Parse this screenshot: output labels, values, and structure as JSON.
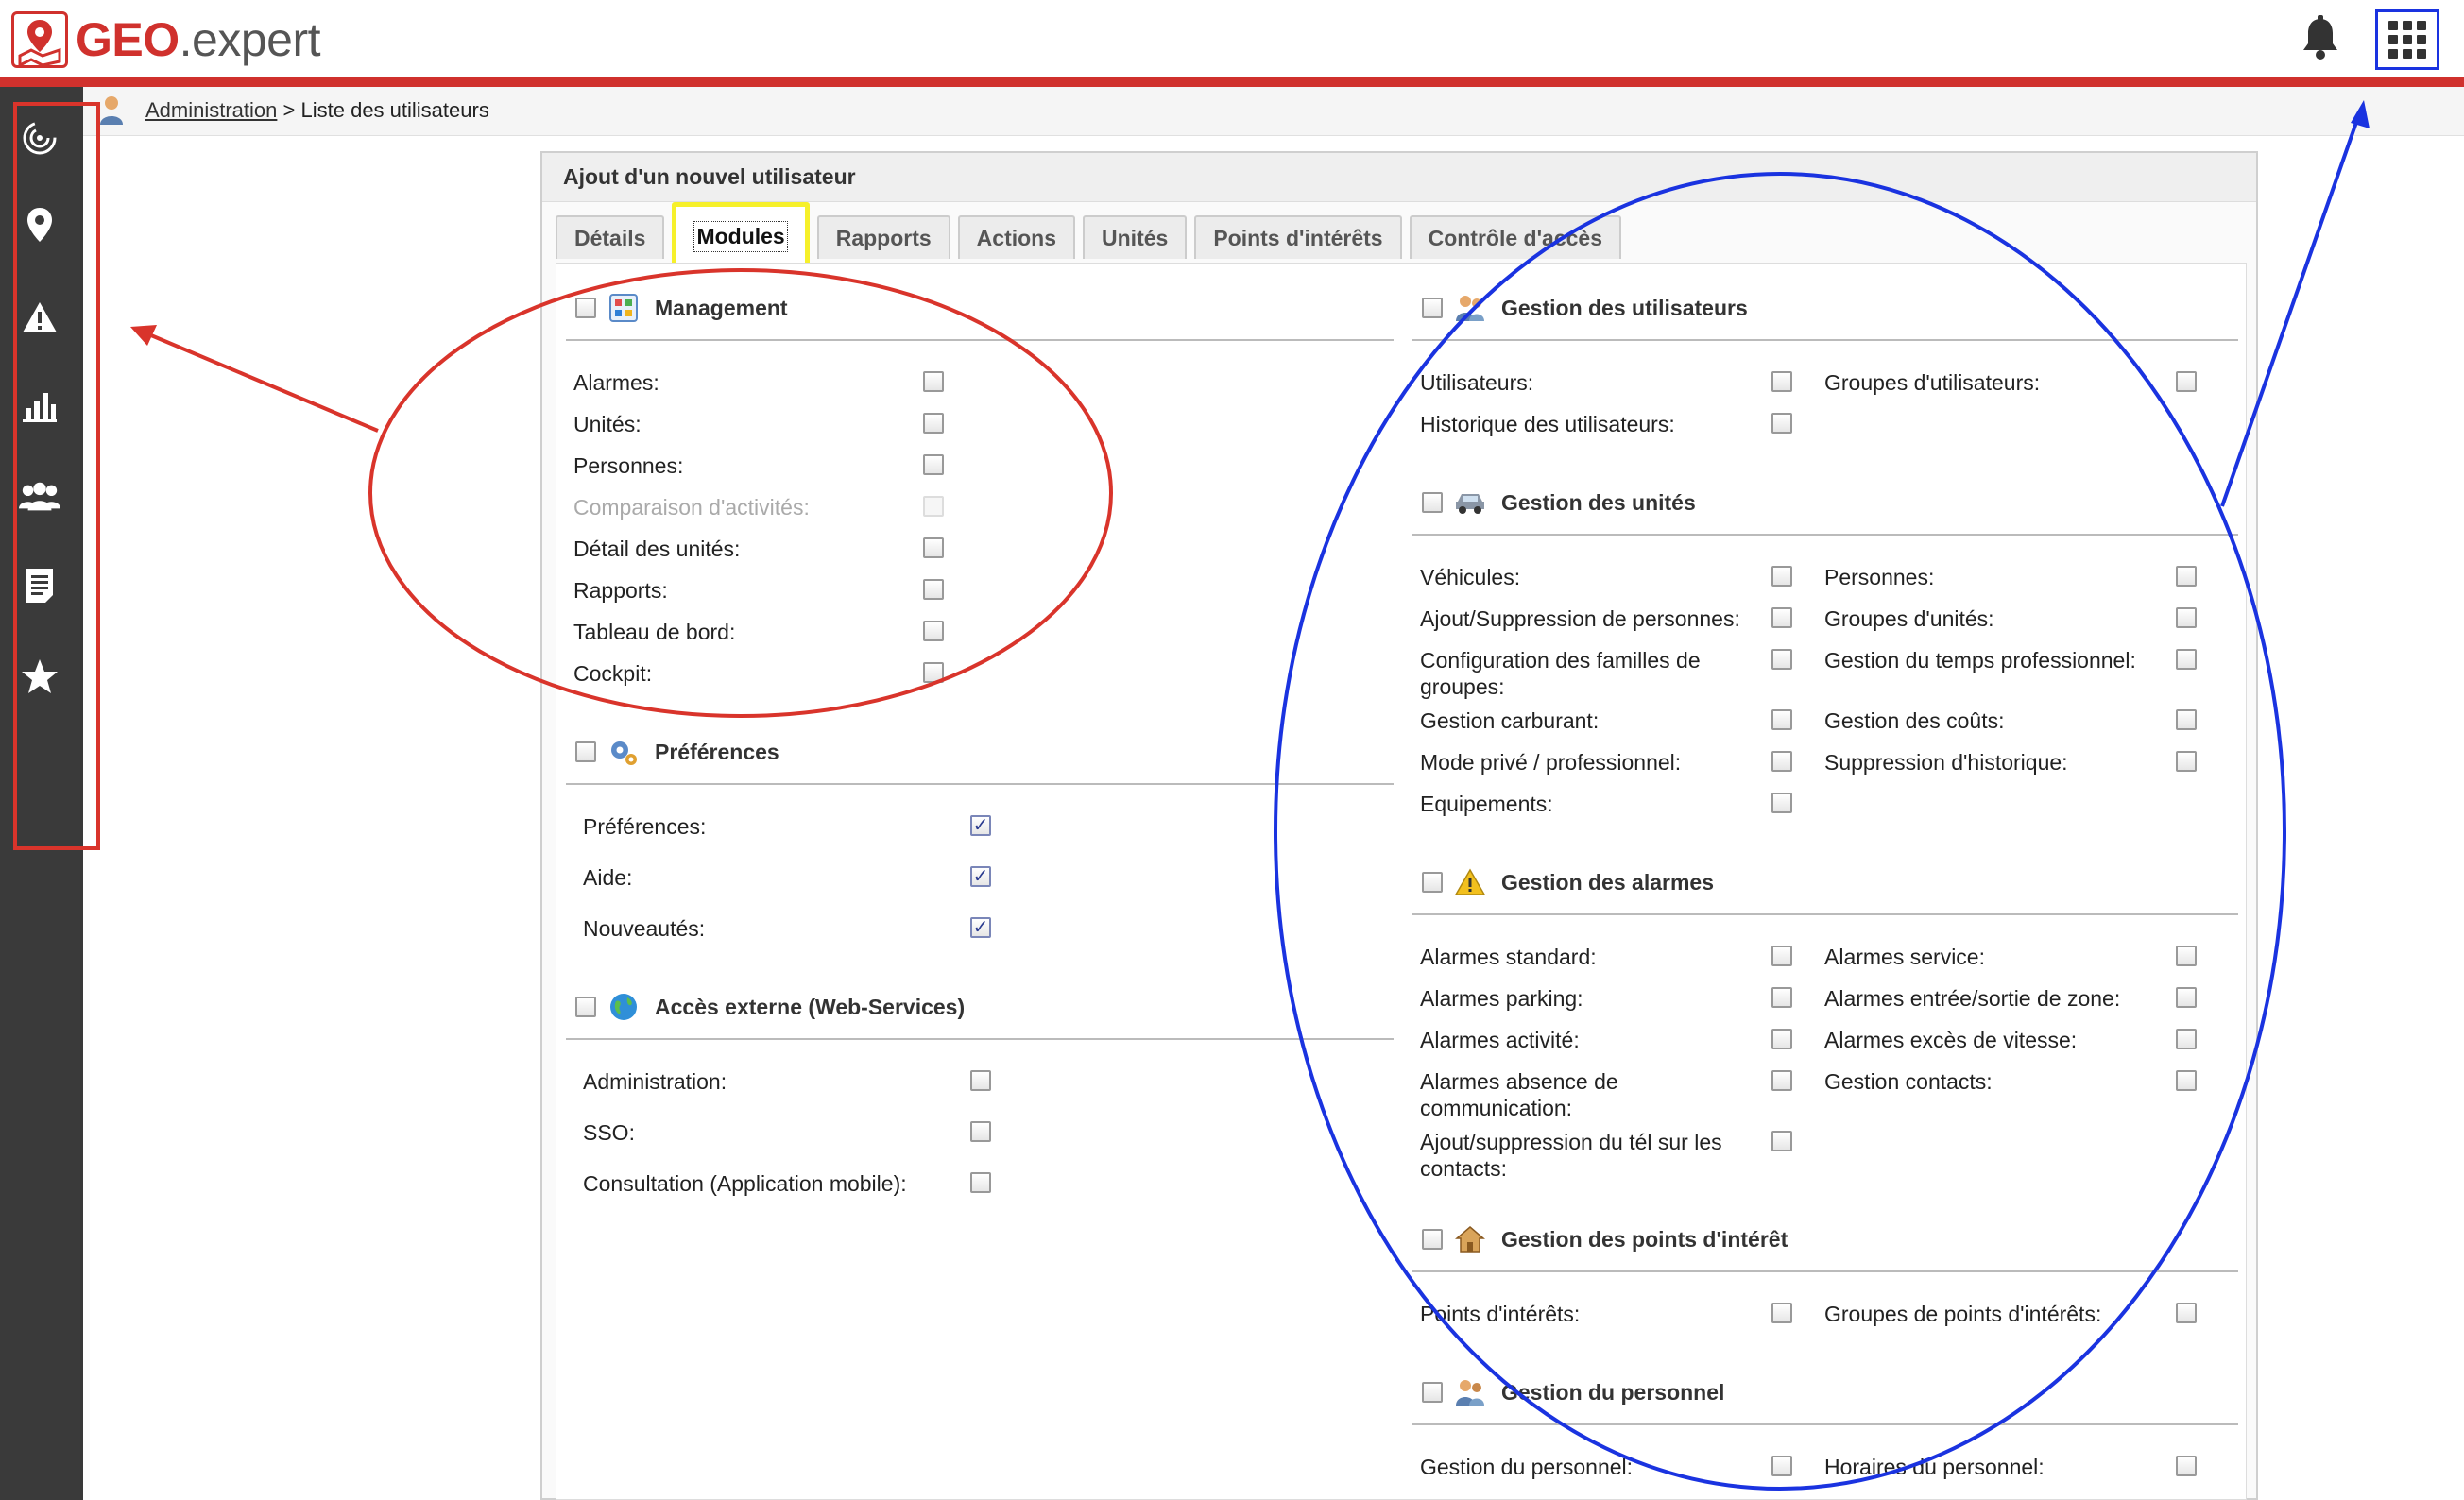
{
  "app": {
    "logo_geo": "GEO",
    "logo_expert": ".expert"
  },
  "breadcrumb": {
    "parent": "Administration",
    "separator": ">",
    "current": "Liste des utilisateurs"
  },
  "panel": {
    "title": "Ajout d'un nouvel utilisateur"
  },
  "tabs": [
    {
      "label": "Détails"
    },
    {
      "label": "Modules"
    },
    {
      "label": "Rapports"
    },
    {
      "label": "Actions"
    },
    {
      "label": "Unités"
    },
    {
      "label": "Points d'intérêts"
    },
    {
      "label": "Contrôle d'accès"
    }
  ],
  "left": {
    "management": {
      "title": "Management",
      "items": [
        "Alarmes:",
        "Unités:",
        "Personnes:",
        "Comparaison d'activités:",
        "Détail des unités:",
        "Rapports:",
        "Tableau de bord:",
        "Cockpit:"
      ]
    },
    "preferences": {
      "title": "Préférences",
      "items": [
        "Préférences:",
        "Aide:",
        "Nouveautés:"
      ]
    },
    "external": {
      "title": "Accès externe (Web-Services)",
      "items": [
        "Administration:",
        "SSO:",
        "Consultation (Application mobile):"
      ]
    }
  },
  "right": {
    "users": {
      "title": "Gestion des utilisateurs",
      "items": [
        "Utilisateurs:",
        "Groupes d'utilisateurs:",
        "Historique des utilisateurs:"
      ]
    },
    "units": {
      "title": "Gestion des unités",
      "items": [
        "Véhicules:",
        "Personnes:",
        "Ajout/Suppression de personnes:",
        "Groupes d'unités:",
        "Configuration des familles de groupes:",
        "Gestion du temps professionnel:",
        "Gestion carburant:",
        "Gestion des coûts:",
        "Mode privé / professionnel:",
        "Suppression d'historique:",
        "Equipements:"
      ]
    },
    "alarms": {
      "title": "Gestion des alarmes",
      "items": [
        "Alarmes standard:",
        "Alarmes service:",
        "Alarmes parking:",
        "Alarmes entrée/sortie de zone:",
        "Alarmes activité:",
        "Alarmes excès de vitesse:",
        "Alarmes absence de communication:",
        "Gestion contacts:",
        "Ajout/suppression du tél sur les contacts:"
      ]
    },
    "poi": {
      "title": "Gestion des points d'intérêt",
      "items": [
        "Points d'intérêts:",
        "Groupes de points d'intérêts:"
      ]
    },
    "staff": {
      "title": "Gestion du personnel",
      "items": [
        "Gestion du personnel:",
        "Horaires du personnel:"
      ]
    }
  },
  "colors": {
    "brand": "#d0312d",
    "sidebar": "#3a3a3a",
    "annot_red": "#d9342b",
    "annot_blue": "#1a33e0",
    "annot_yellow": "#f6f02a"
  }
}
